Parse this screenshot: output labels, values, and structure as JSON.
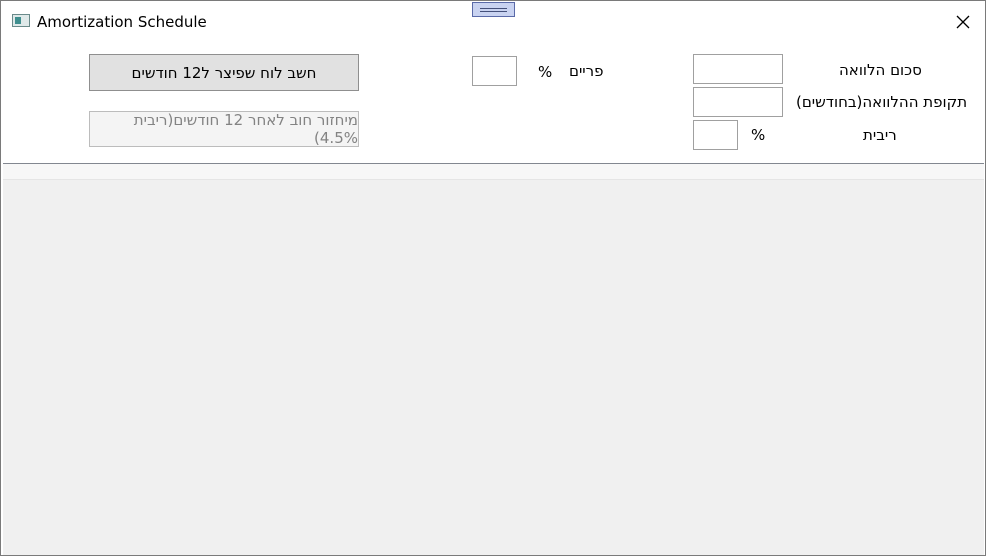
{
  "window": {
    "title": "Amortization Schedule"
  },
  "form": {
    "loan_amount_label": "סכום הלוואה",
    "loan_amount_value": "",
    "loan_period_label": "תקופת ההלוואה(בחודשים)",
    "loan_period_value": "",
    "interest_label": "ריבית",
    "interest_value": "",
    "interest_unit": "%",
    "prime_label": "פריים",
    "prime_value": "",
    "prime_unit": "%"
  },
  "actions": {
    "calculate_label": "חשב לוח שפיצר ל12 חודשים",
    "recycle_label": "מיחזור חוב לאחר 12 חודשים(ריבית 4.5%)"
  },
  "schedule_grid": {
    "rows": []
  }
}
